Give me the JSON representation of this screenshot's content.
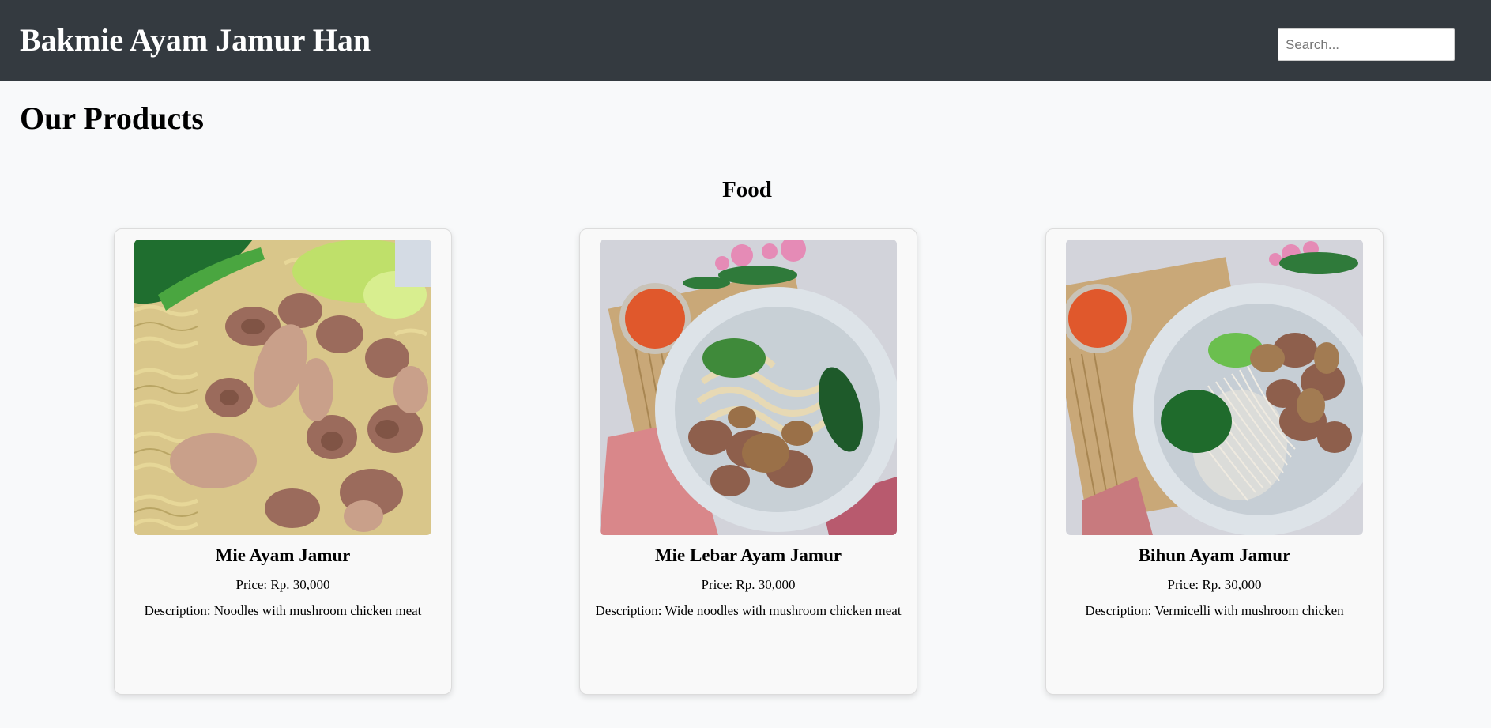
{
  "header": {
    "brand": "Bakmie Ayam Jamur Han",
    "search_placeholder": "Search..."
  },
  "main": {
    "title": "Our Products",
    "section": "Food",
    "products": [
      {
        "name": "Mie Ayam Jamur",
        "price": "Price: Rp. 30,000",
        "description": "Description: Noodles with mushroom chicken meat",
        "image": "mie-ayam-jamur-photo"
      },
      {
        "name": "Mie Lebar Ayam Jamur",
        "price": "Price: Rp. 30,000",
        "description": "Description: Wide noodles with mushroom chicken meat",
        "image": "mie-lebar-ayam-jamur-photo"
      },
      {
        "name": "Bihun Ayam Jamur",
        "price": "Price: Rp. 30,000",
        "description": "Description: Vermicelli with mushroom chicken",
        "image": "bihun-ayam-jamur-photo"
      }
    ]
  },
  "colors": {
    "header_bg": "#343a40",
    "page_bg": "#f8f9fa",
    "card_bg": "#f9f9f9"
  }
}
